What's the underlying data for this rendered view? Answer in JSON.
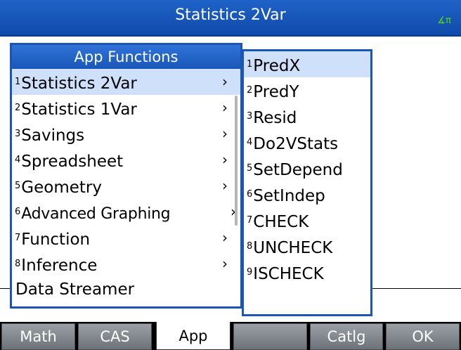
{
  "title": "Statistics 2Var",
  "angle_indicator": "∡π",
  "left_menu": {
    "header": "App Functions",
    "items": [
      {
        "num": "1",
        "label": "Statistics 2Var"
      },
      {
        "num": "2",
        "label": "Statistics 1Var"
      },
      {
        "num": "3",
        "label": "Savings"
      },
      {
        "num": "4",
        "label": "Spreadsheet"
      },
      {
        "num": "5",
        "label": "Geometry"
      },
      {
        "num": "6",
        "label": "Advanced Graphing"
      },
      {
        "num": "7",
        "label": "Function"
      },
      {
        "num": "8",
        "label": "Inference"
      },
      {
        "num": "",
        "label": "Data Streamer"
      }
    ],
    "chevron": "›"
  },
  "right_menu": {
    "items": [
      {
        "num": "1",
        "label": "PredX"
      },
      {
        "num": "2",
        "label": "PredY"
      },
      {
        "num": "3",
        "label": "Resid"
      },
      {
        "num": "4",
        "label": "Do2VStats"
      },
      {
        "num": "5",
        "label": "SetDepend"
      },
      {
        "num": "6",
        "label": "SetIndep"
      },
      {
        "num": "7",
        "label": "CHECK"
      },
      {
        "num": "8",
        "label": "UNCHECK"
      },
      {
        "num": "9",
        "label": "ISCHECK"
      }
    ]
  },
  "softkeys": [
    "Math",
    "CAS",
    "App",
    "",
    "Catlg",
    "OK"
  ],
  "colors": {
    "title_bar": "#1a56b8",
    "selection": "#cfe0fb",
    "angle_indicator": "#59e000"
  }
}
